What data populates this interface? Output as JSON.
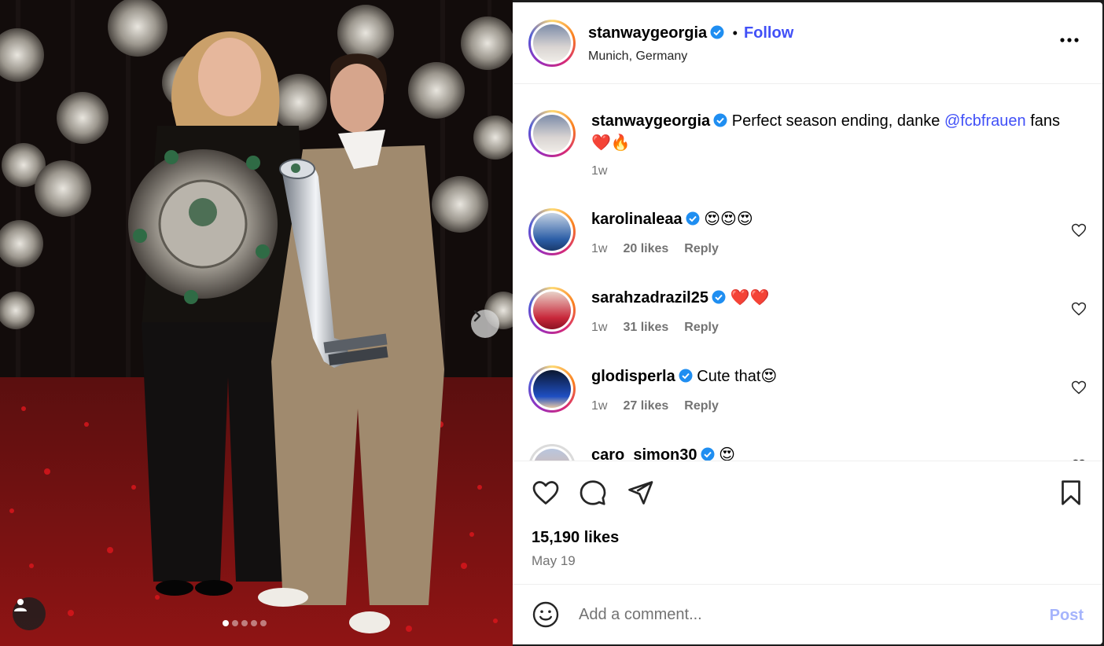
{
  "post": {
    "author": "stanwaygeorgia",
    "follow_label": "Follow",
    "separator": "•",
    "location": "Munich, Germany",
    "caption_text": "Perfect season ending, danke",
    "caption_mention": "@fcbfrauen",
    "caption_after": "fans",
    "caption_emojis": "❤️🔥",
    "caption_age": "1w",
    "likes": "15,190 likes",
    "date": "May 19"
  },
  "comments": [
    {
      "user": "karolinaleaa",
      "text": "😍😍😍",
      "age": "1w",
      "likes": "20 likes",
      "reply": "Reply"
    },
    {
      "user": "sarahzadrazil25",
      "text": "❤️❤️",
      "age": "1w",
      "likes": "31 likes",
      "reply": "Reply"
    },
    {
      "user": "glodisperla",
      "text": "Cute that😍",
      "age": "1w",
      "likes": "27 likes",
      "reply": "Reply"
    },
    {
      "user": "caro_simon30",
      "text": "😍",
      "age": "",
      "likes": "",
      "reply": ""
    }
  ],
  "add_comment": {
    "placeholder": "Add a comment...",
    "post_label": "Post"
  },
  "carousel": {
    "count": 5,
    "active": 0
  },
  "colors": {
    "link": "#4150f7",
    "muted": "#737373",
    "post_disabled": "#a5b4fc"
  }
}
